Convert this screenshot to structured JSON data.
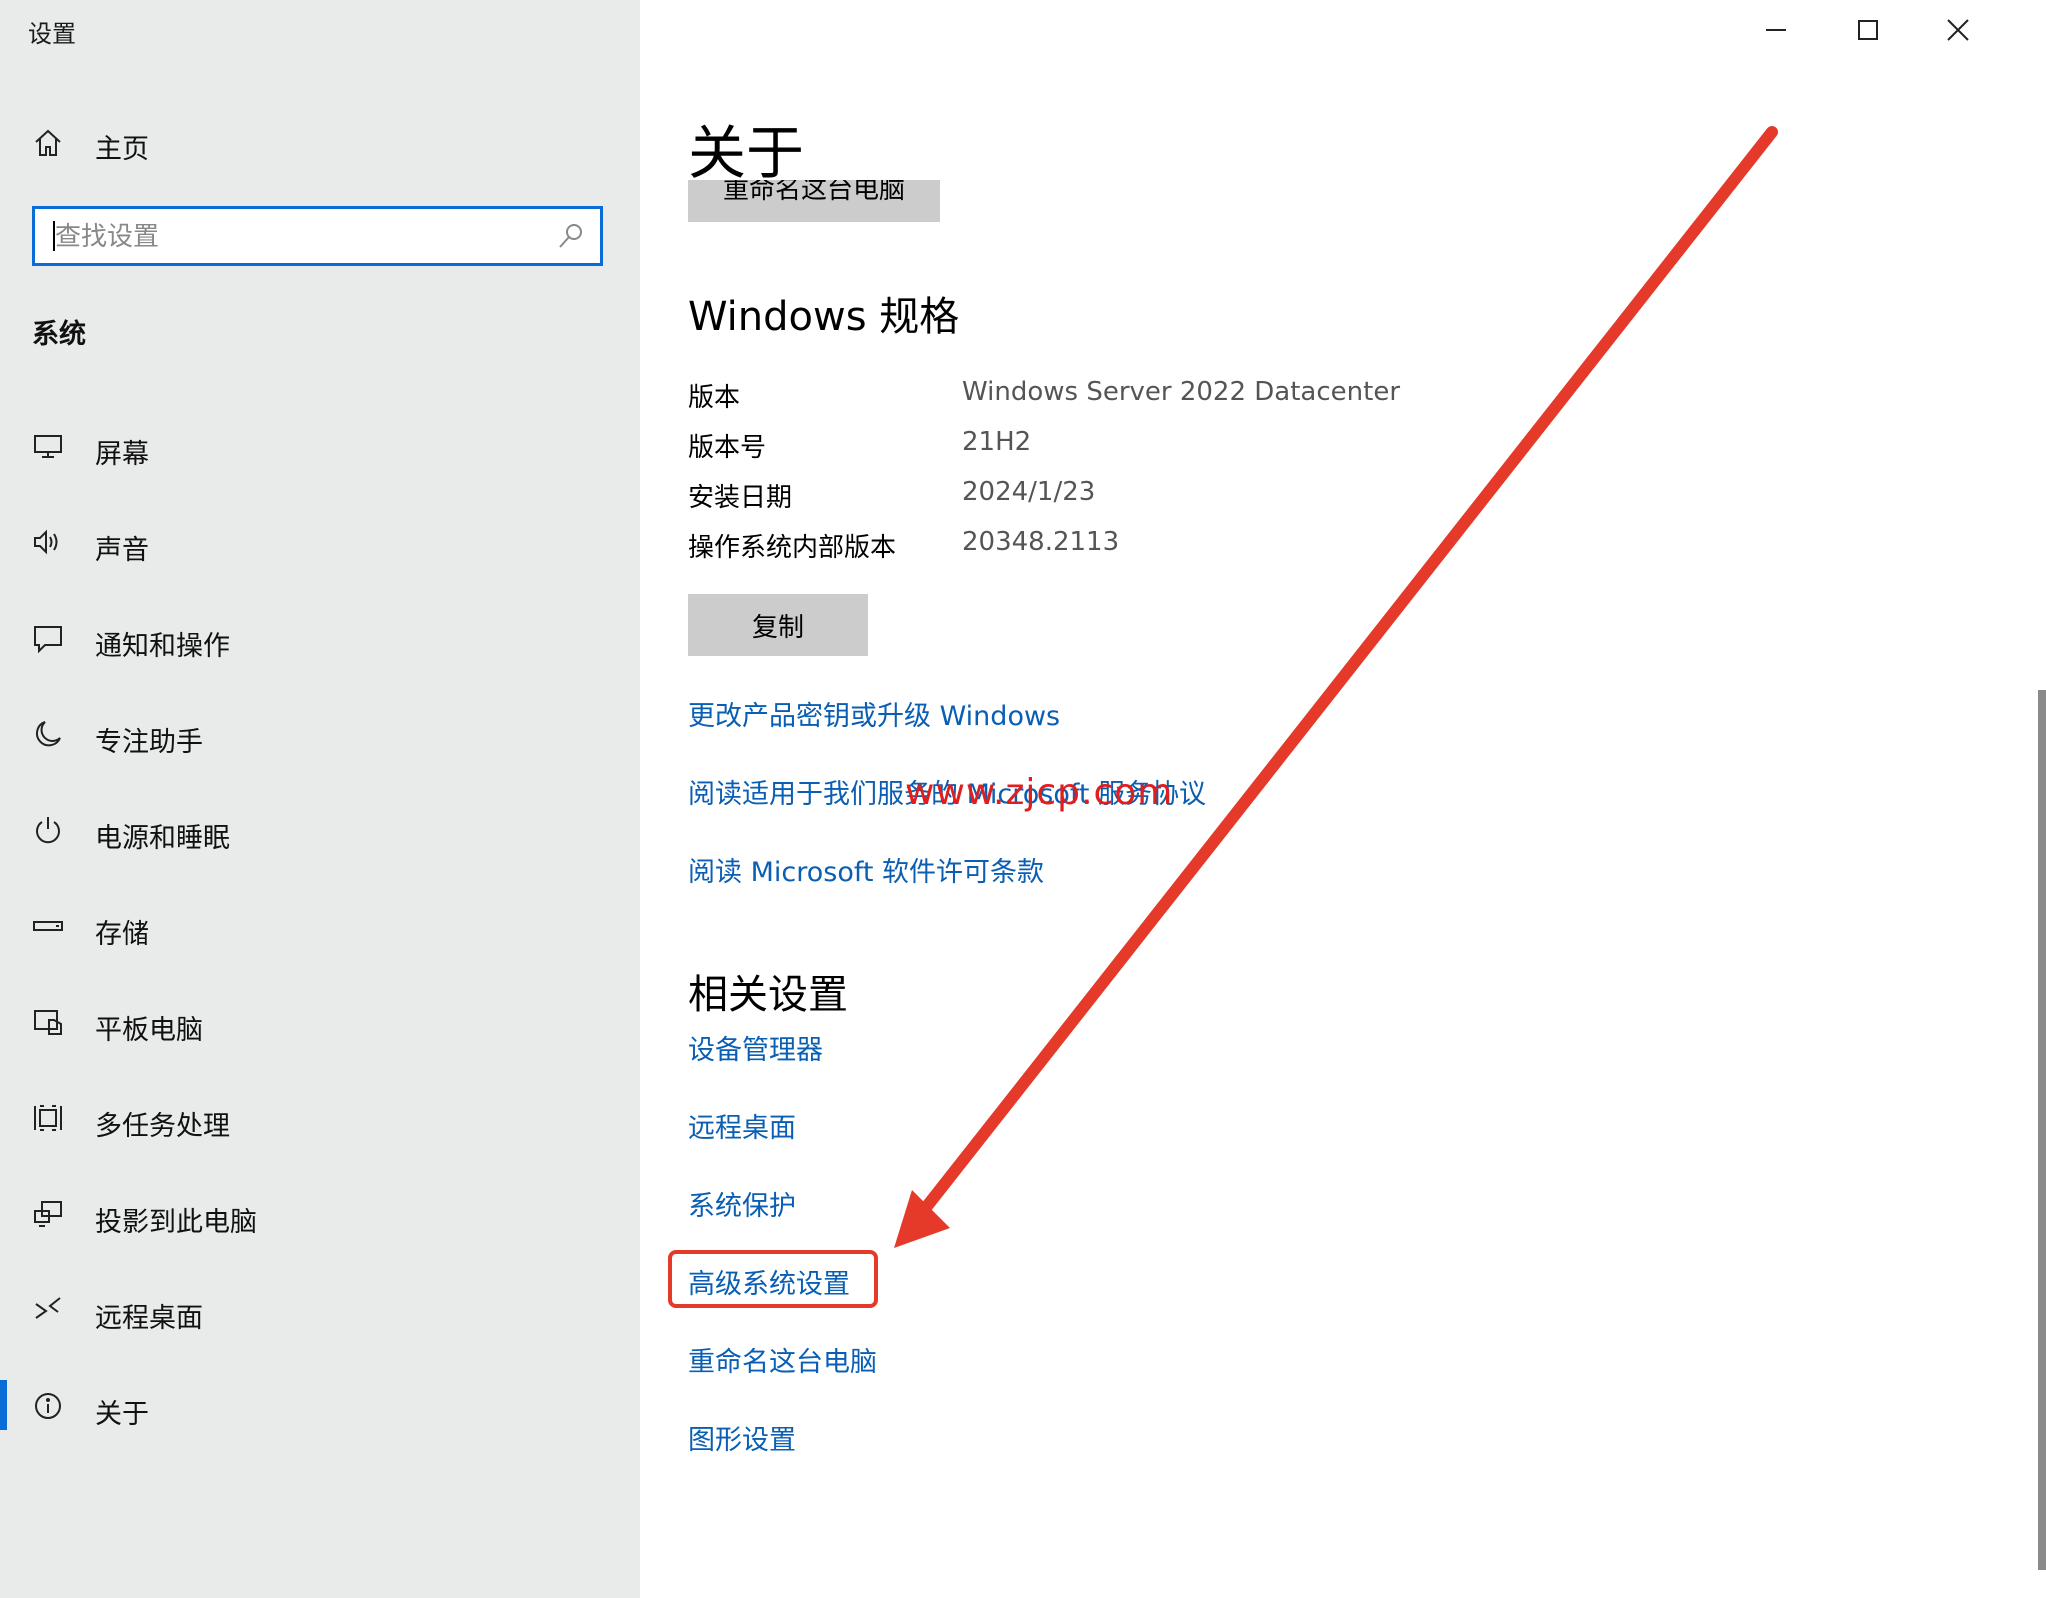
{
  "window": {
    "title": "设置",
    "controls": [
      "minimize-icon",
      "maximize-icon",
      "close-icon"
    ]
  },
  "sidebar": {
    "home_label": "主页",
    "search": {
      "placeholder": "查找设置",
      "value": ""
    },
    "section_title": "系统",
    "items": [
      {
        "label": "屏幕",
        "icon": "monitor-icon"
      },
      {
        "label": "声音",
        "icon": "speaker-icon"
      },
      {
        "label": "通知和操作",
        "icon": "message-icon"
      },
      {
        "label": "专注助手",
        "icon": "moon-icon"
      },
      {
        "label": "电源和睡眠",
        "icon": "power-icon"
      },
      {
        "label": "存储",
        "icon": "storage-icon"
      },
      {
        "label": "平板电脑",
        "icon": "tablet-icon"
      },
      {
        "label": "多任务处理",
        "icon": "multitask-icon"
      },
      {
        "label": "投影到此电脑",
        "icon": "project-icon"
      },
      {
        "label": "远程桌面",
        "icon": "remote-icon"
      },
      {
        "label": "关于",
        "icon": "info-icon",
        "active": true
      }
    ]
  },
  "main": {
    "title": "关于",
    "rename_button_label": "重命名这台电脑",
    "spec_title": "Windows 规格",
    "specs": [
      {
        "label": "版本",
        "value": "Windows Server 2022 Datacenter"
      },
      {
        "label": "版本号",
        "value": "21H2"
      },
      {
        "label": "安装日期",
        "value": "2024/1/23"
      },
      {
        "label": "操作系统内部版本",
        "value": "20348.2113"
      }
    ],
    "copy_button_label": "复制",
    "links": [
      "更改产品密钥或升级 Windows",
      "阅读适用于我们服务的 Microsoft 服务协议",
      "阅读 Microsoft 软件许可条款"
    ],
    "related_title": "相关设置",
    "related_links": [
      "设备管理器",
      "远程桌面",
      "系统保护",
      "高级系统设置",
      "重命名这台电脑",
      "图形设置"
    ]
  },
  "annotation": {
    "watermark": "www.zjcp.com",
    "highlight_target": "高级系统设置",
    "color": "#e53a2a"
  }
}
